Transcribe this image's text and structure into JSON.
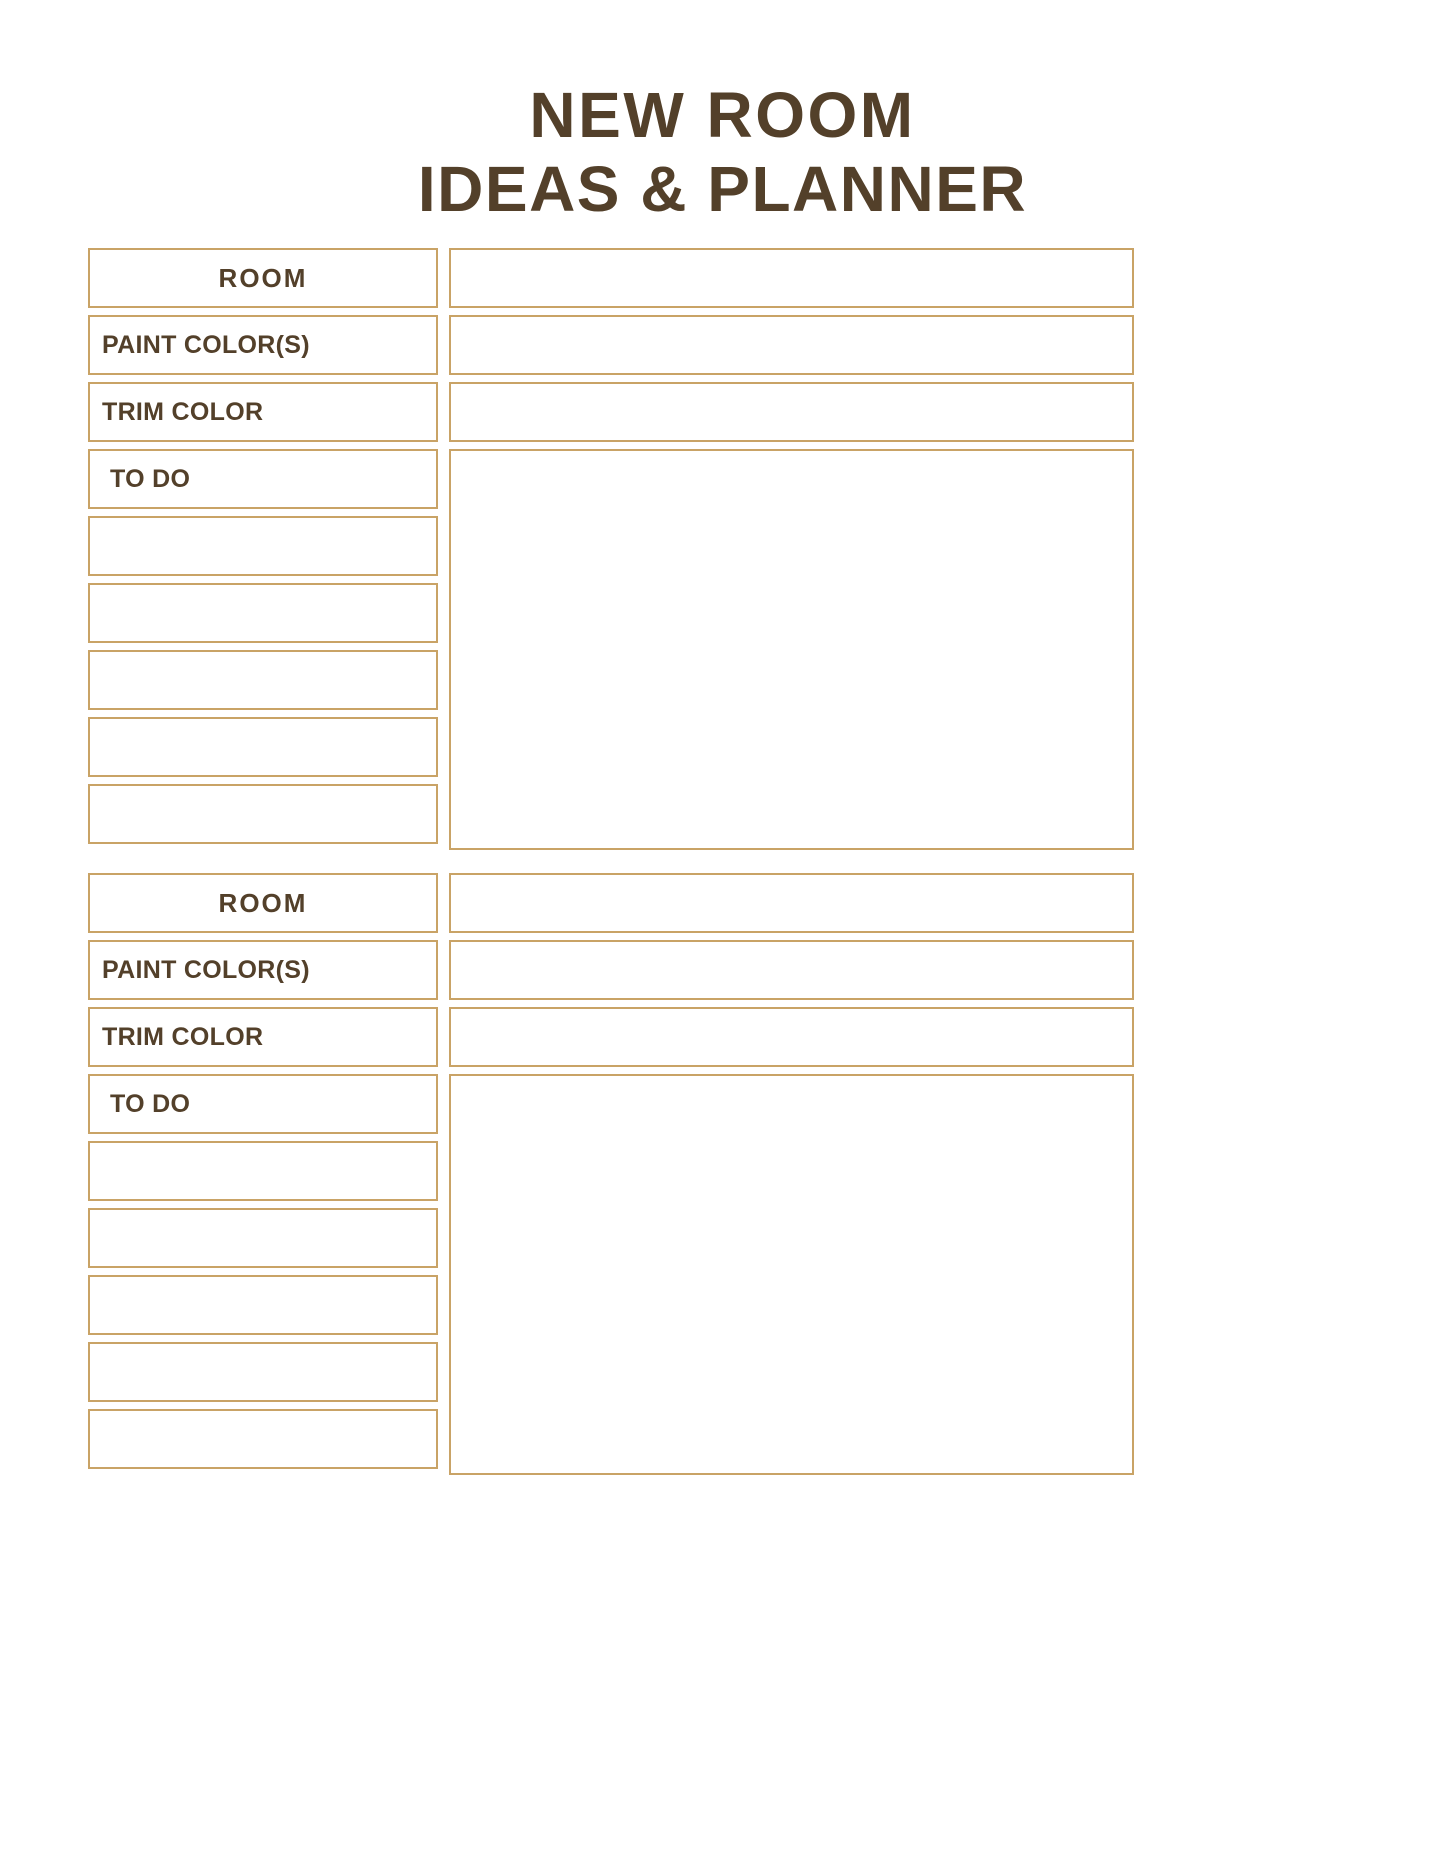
{
  "document": {
    "title_line_1": "NEW ROOM",
    "title_line_2": "IDEAS & PLANNER",
    "accent_border_color": "#C9A366",
    "text_color": "#53402A",
    "background_color": "#FFFFFF"
  },
  "sections": [
    {
      "id": "room-entry-1",
      "labels": {
        "room": "ROOM",
        "paint_color": "PAINT COLOR(S)",
        "trim_color": "TRIM COLOR",
        "to_do": "TO DO"
      },
      "values": {
        "room": "",
        "paint_color": "",
        "trim_color": "",
        "notes": ""
      },
      "checklist": [
        "",
        "",
        "",
        "",
        ""
      ]
    },
    {
      "id": "room-entry-2",
      "labels": {
        "room": "ROOM",
        "paint_color": "PAINT COLOR(S)",
        "trim_color": "TRIM COLOR",
        "to_do": "TO DO"
      },
      "values": {
        "room": "",
        "paint_color": "",
        "trim_color": "",
        "notes": ""
      },
      "checklist": [
        "",
        "",
        "",
        "",
        ""
      ]
    }
  ]
}
